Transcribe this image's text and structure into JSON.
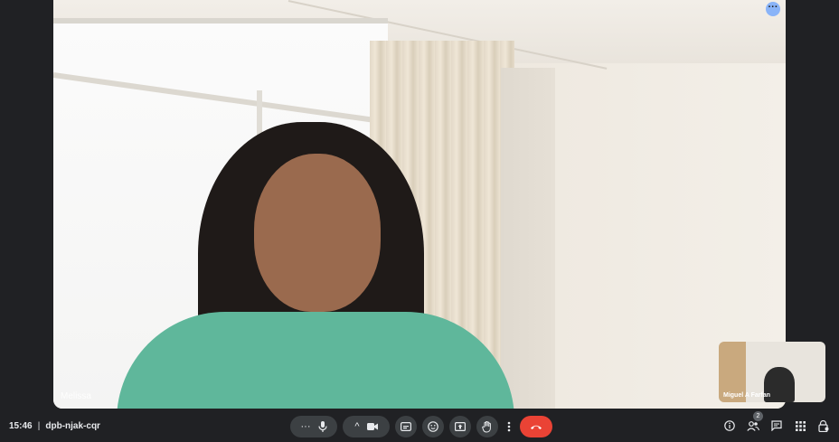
{
  "main_video": {
    "participant_name": "Melissa"
  },
  "self_view": {
    "participant_name": "Miguel A Farfan"
  },
  "meeting": {
    "time": "15:46",
    "separator": "|",
    "code": "dpb-njak-cqr"
  },
  "controls": {
    "more_glyph": "···",
    "chevron_glyph": "^"
  },
  "participants_badge": "2",
  "icons": {
    "more_options": "more-vert-icon",
    "microphone": "microphone-icon",
    "camera": "camera-icon",
    "captions": "captions-icon",
    "emoji": "emoji-icon",
    "present": "present-screen-icon",
    "raise_hand": "raise-hand-icon",
    "hangup": "hangup-icon",
    "info": "info-icon",
    "people": "people-icon",
    "chat": "chat-icon",
    "activities": "apps-grid-icon",
    "host_controls": "lock-person-icon"
  },
  "colors": {
    "background": "#202124",
    "control": "#3c4043",
    "hangup": "#ea4335",
    "accent": "#8ab4f8"
  }
}
